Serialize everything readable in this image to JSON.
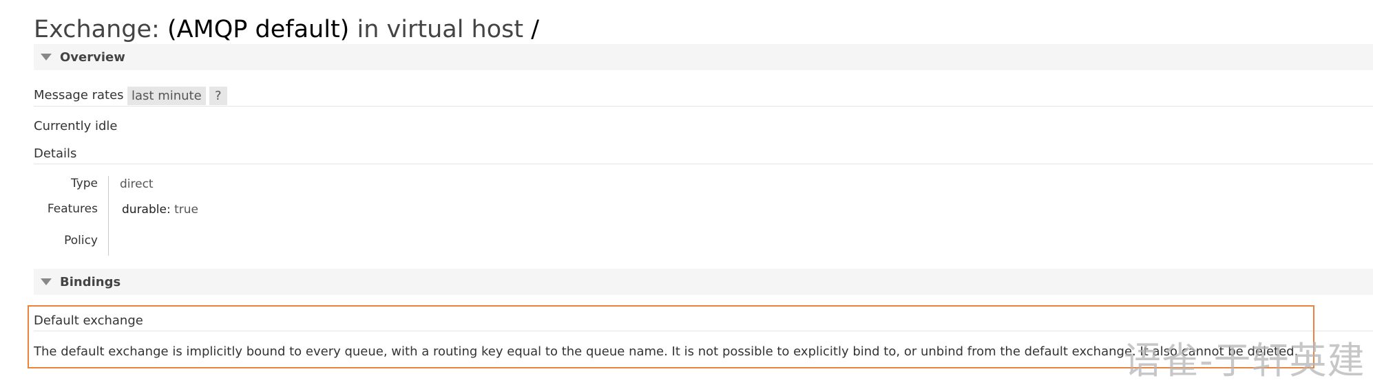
{
  "page": {
    "title_prefix": "Exchange:",
    "title_name": "(AMQP default)",
    "title_middle": "in virtual host",
    "title_vhost": "/"
  },
  "overview": {
    "header": "Overview",
    "message_rates_label": "Message rates",
    "rate_range": "last minute",
    "help_label": "?",
    "idle_text": "Currently idle",
    "details_label": "Details",
    "details": {
      "type_label": "Type",
      "type_value": "direct",
      "features_label": "Features",
      "durable_key": "durable:",
      "durable_value": "true",
      "policy_label": "Policy"
    }
  },
  "bindings": {
    "header": "Bindings",
    "default_exchange_label": "Default exchange",
    "default_exchange_desc": "The default exchange is implicitly bound to every queue, with a routing key equal to the queue name. It is not possible to explicitly bind to, or unbind from the default exchange. It also cannot be deleted."
  },
  "watermark": {
    "text": "语雀-于轩英建"
  },
  "colors": {
    "highlight_border": "#e8823c",
    "section_bg": "#f5f5f5",
    "pill_bg": "#e6e6e6"
  }
}
